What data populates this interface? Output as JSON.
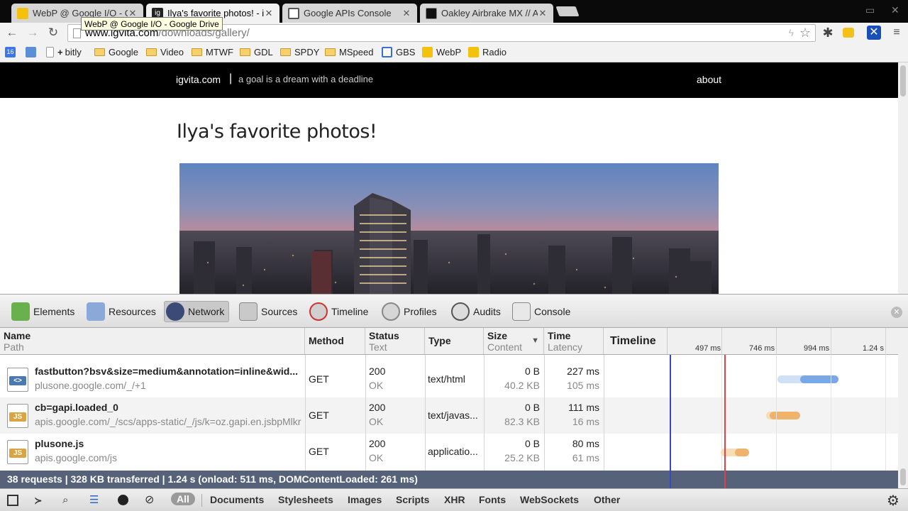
{
  "browser": {
    "tabs": [
      {
        "title": "WebP @ Google I/O - Goo",
        "active": false
      },
      {
        "title": "Ilya's favorite photos! - ig",
        "active": true
      },
      {
        "title": "Google APIs Console",
        "active": false
      },
      {
        "title": "Oakley Airbrake MX // A",
        "active": false
      }
    ],
    "tooltip": "WebP @ Google I/O - Google Drive",
    "url_host": "www.igvita.com",
    "url_path": "/downloads/gallery/",
    "bookmarks": [
      "bitly",
      "Google",
      "Video",
      "MTWF",
      "GDL",
      "SPDY",
      "MSpeed",
      "GBS",
      "WebP",
      "Radio"
    ],
    "favicon_labels": {
      "tab2": "ig",
      "calendar": "16"
    }
  },
  "site": {
    "brand": "igvita.com",
    "separator": "|",
    "tagline": "a goal is a dream with a deadline",
    "nav_about": "about",
    "heading": "Ilya's favorite photos!"
  },
  "devtools": {
    "panels": [
      "Elements",
      "Resources",
      "Network",
      "Sources",
      "Timeline",
      "Profiles",
      "Audits",
      "Console"
    ],
    "selected_panel": "Network",
    "columns": {
      "name": "Name",
      "path": "Path",
      "method": "Method",
      "status": "Status",
      "status_text": "Text",
      "type": "Type",
      "size": "Size",
      "content": "Content",
      "time": "Time",
      "latency": "Latency",
      "timeline": "Timeline"
    },
    "timeline_ticks": [
      "497 ms",
      "746 ms",
      "994 ms",
      "1.24 s"
    ],
    "requests": [
      {
        "name": "fastbutton?bsv&size=medium&annotation=inline&wid...",
        "path": "plusone.google.com/_/+1",
        "method": "GET",
        "status": "200",
        "status_text": "OK",
        "type": "text/html",
        "size": "0 B",
        "content": "40.2 KB",
        "time": "227 ms",
        "latency": "105 ms",
        "icon": "html-file-icon",
        "icon_label": "<>"
      },
      {
        "name": "cb=gapi.loaded_0",
        "path": "apis.google.com/_/scs/apps-static/_/js/k=oz.gapi.en.jsbpMlkr",
        "method": "GET",
        "status": "200",
        "status_text": "OK",
        "type": "text/javas...",
        "size": "0 B",
        "content": "82.3 KB",
        "time": "111 ms",
        "latency": "16 ms",
        "icon": "js-file-icon",
        "icon_label": "JS"
      },
      {
        "name": "plusone.js",
        "path": "apis.google.com/js",
        "method": "GET",
        "status": "200",
        "status_text": "OK",
        "type": "applicatio...",
        "size": "0 B",
        "content": "25.2 KB",
        "time": "80 ms",
        "latency": "61 ms",
        "icon": "js-file-icon",
        "icon_label": "JS"
      }
    ],
    "summary": "38 requests  |  328 KB transferred  |  1.24 s (onload: 511 ms, DOMContentLoaded: 261 ms)",
    "filters": [
      "All",
      "Documents",
      "Stylesheets",
      "Images",
      "Scripts",
      "XHR",
      "Fonts",
      "WebSockets",
      "Other"
    ],
    "selected_filter": "All"
  },
  "colors": {
    "html_bar": "#7aa7e6",
    "script_bar": "#f0b36c",
    "domcontentloaded_line": "#3b46c7",
    "onload_line": "#e0424a",
    "summary_bg": "#56627a"
  }
}
